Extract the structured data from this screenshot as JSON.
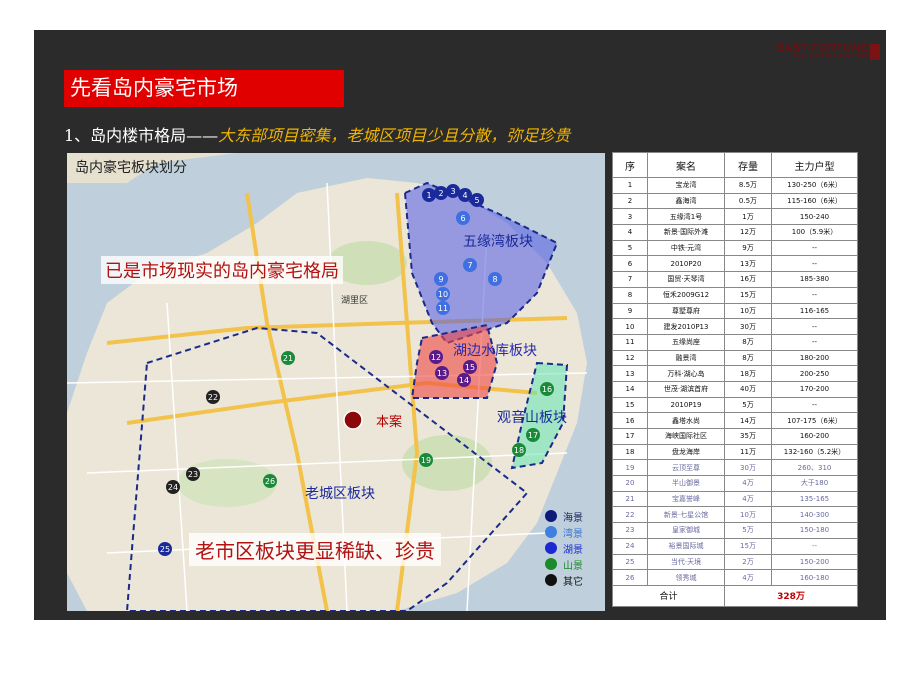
{
  "logo": {
    "main": "EAST FORTUNE",
    "sub": "REAL ESTATE MARKETING"
  },
  "banner": "先看岛内豪宅市场",
  "subtitle": {
    "prefix": "1、岛内楼市格局——",
    "highlight": "大东部项目密集，老城区项目少且分散，弥足珍贵"
  },
  "map": {
    "title": "岛内豪宅板块划分",
    "callout_top": "已是市场现实的岛内豪宅格局",
    "callout_bottom": "老市区板块更显稀缺、珍贵",
    "zones": {
      "wuyuan": "五缘湾板块",
      "hubian": "湖边水库板块",
      "guanyin": "观音山板块",
      "laocheng": "老城区板块"
    },
    "project_label": "本案",
    "map_labels": {
      "huli": "湖里区"
    },
    "legend": [
      {
        "label": "海景",
        "color": "#0d1a7a",
        "text_color": "#1a1a5a"
      },
      {
        "label": "湾景",
        "color": "#3f7fe0",
        "text_color": "#3a70d8"
      },
      {
        "label": "湖景",
        "color": "#1a2ad0",
        "text_color": "#1a2ad0"
      },
      {
        "label": "山景",
        "color": "#1a8a2a",
        "text_color": "#1a8a2a"
      },
      {
        "label": "其它",
        "color": "#111111",
        "text_color": "#111111"
      }
    ],
    "markers": [
      "1",
      "2",
      "3",
      "4",
      "5",
      "6",
      "7",
      "8",
      "9",
      "10",
      "11",
      "12",
      "13",
      "14",
      "15",
      "16",
      "17",
      "18",
      "19",
      "21",
      "22",
      "23",
      "24",
      "25",
      "26"
    ]
  },
  "colors": {
    "banner": "#e00000",
    "highlight": "#f0b400",
    "slide_bg": "#2b2b2b"
  },
  "table": {
    "headers": [
      "序",
      "案名",
      "存量",
      "主力户型"
    ],
    "rows": [
      [
        "1",
        "宝龙湾",
        "8.5万",
        "130-250（6米）"
      ],
      [
        "2",
        "鑫海湾",
        "0.5万",
        "115-160（6米）"
      ],
      [
        "3",
        "五缘湾1号",
        "1万",
        "150-240"
      ],
      [
        "4",
        "新景·国际外滩",
        "12万",
        "100（5.9米）"
      ],
      [
        "5",
        "中铁·元湾",
        "9万",
        "--"
      ],
      [
        "6",
        "2010P20",
        "13万",
        "--"
      ],
      [
        "7",
        "国贸·天琴湾",
        "16万",
        "185-380"
      ],
      [
        "8",
        "恒禾2009G12",
        "15万",
        "--"
      ],
      [
        "9",
        "尊墅尊府",
        "10万",
        "116-165"
      ],
      [
        "10",
        "建发2010P13",
        "30万",
        "--"
      ],
      [
        "11",
        "五缘尚座",
        "8万",
        "--"
      ],
      [
        "12",
        "融景湾",
        "8万",
        "180-200"
      ],
      [
        "13",
        "万科·湖心岛",
        "18万",
        "200-250"
      ],
      [
        "14",
        "世茂·湖滨首府",
        "40万",
        "170-200"
      ],
      [
        "15",
        "2010P19",
        "5万",
        "--"
      ],
      [
        "16",
        "鑫塔水尚",
        "14万",
        "107-175（6米）"
      ],
      [
        "17",
        "海峡国际社区",
        "35万",
        "160-200"
      ],
      [
        "18",
        "盘龙海岸",
        "11万",
        "132-160（5.2米）"
      ],
      [
        "19",
        "云顶至尊",
        "30万",
        "260、310"
      ],
      [
        "20",
        "半山御景",
        "4万",
        "大于180"
      ],
      [
        "21",
        "宝嘉誉峰",
        "4万",
        "135-165"
      ],
      [
        "22",
        "新景·七星公馆",
        "10万",
        "140-300"
      ],
      [
        "23",
        "皇家御城",
        "5万",
        "150-180"
      ],
      [
        "24",
        "裕景国际城",
        "15万",
        "--"
      ],
      [
        "25",
        "当代·天境",
        "2万",
        "150-200"
      ],
      [
        "26",
        "领秀城",
        "4万",
        "160-180"
      ]
    ],
    "total_label": "合计",
    "total_value": "328万"
  }
}
